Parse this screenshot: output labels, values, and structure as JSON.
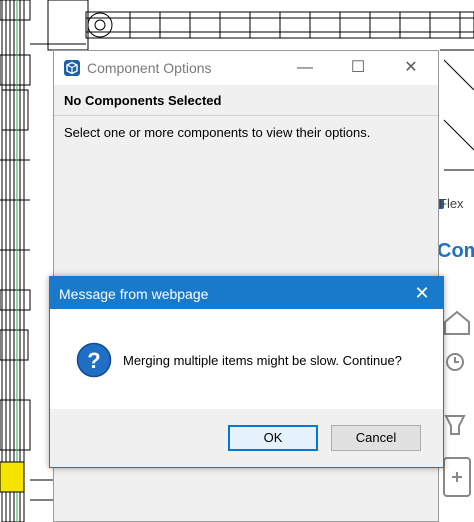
{
  "component_options": {
    "title": "Component Options",
    "header": "No Components Selected",
    "message": "Select one or more components to view their options.",
    "controls": {
      "minimize": "—",
      "maximize": "☐",
      "close": "✕"
    }
  },
  "side_panel": {
    "flex_label": "Flex",
    "com_label": "Com"
  },
  "dialog": {
    "title": "Message from webpage",
    "close_glyph": "✕",
    "message": "Merging multiple items might be slow. Continue?",
    "ok_label": "OK",
    "cancel_label": "Cancel",
    "icon": "question-icon",
    "accent_color": "#1979ca"
  }
}
